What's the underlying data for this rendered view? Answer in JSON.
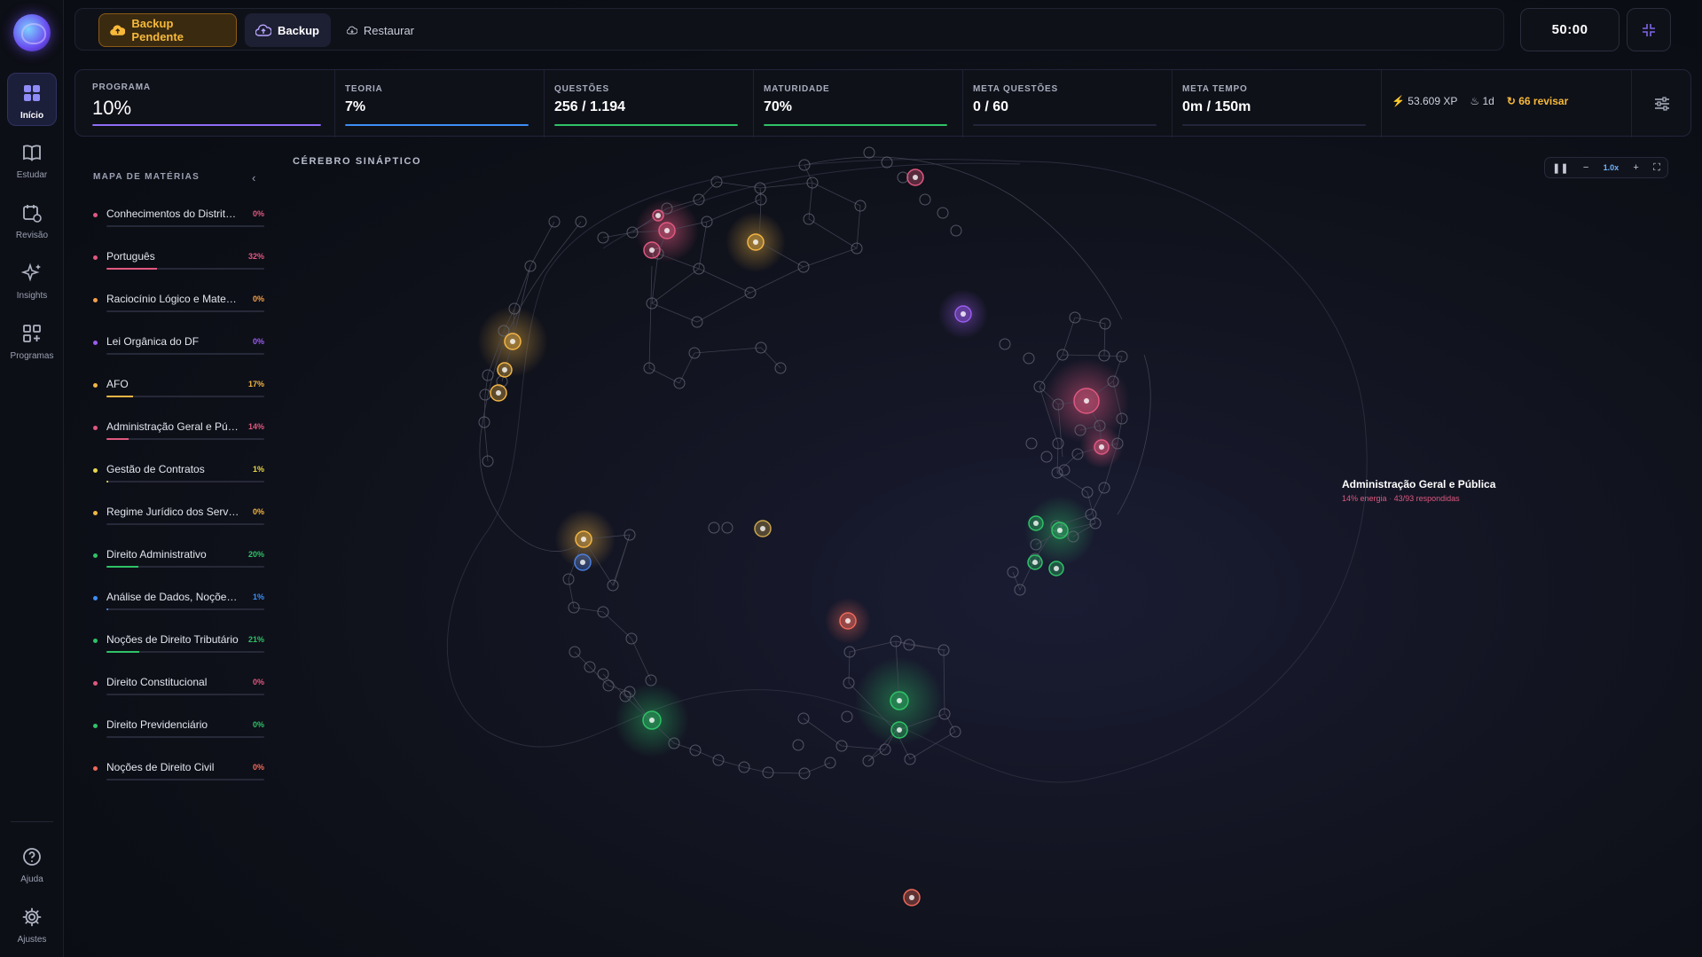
{
  "nav": {
    "items": [
      {
        "label": "Início",
        "icon": "grid-icon"
      },
      {
        "label": "Estudar",
        "icon": "book-icon"
      },
      {
        "label": "Revisão",
        "icon": "calendar-icon"
      },
      {
        "label": "Insights",
        "icon": "sparkles-icon"
      },
      {
        "label": "Programas",
        "icon": "apps-icon"
      }
    ],
    "bottom": [
      {
        "label": "Ajuda",
        "icon": "help-icon"
      },
      {
        "label": "Ajustes",
        "icon": "gear-icon"
      }
    ]
  },
  "topbar": {
    "backup_pending": "Backup Pendente",
    "backup": "Backup",
    "restore": "Restaurar",
    "timer": "50:00"
  },
  "stats": {
    "programa": {
      "label": "PROGRAMA",
      "value": "10%",
      "progress": 1.0,
      "color": "#8f6cf7"
    },
    "teoria": {
      "label": "TEORIA",
      "value": "7%",
      "progress": 1.0,
      "color": "#3d8df5"
    },
    "questoes": {
      "label": "QUESTÕES",
      "value": "256 / 1.194",
      "progress": 1.0,
      "color": "#2fc267"
    },
    "maturidade": {
      "label": "MATURIDADE",
      "value": "70%",
      "progress": 1.0,
      "color": "#2fc267"
    },
    "meta_questoes": {
      "label": "META QUESTÕES",
      "value": "0 / 60",
      "progress": 0,
      "color": "#f7b93a"
    },
    "meta_tempo": {
      "label": "META TEMPO",
      "value": "0m / 150m",
      "progress": 0,
      "color": "#e0587f"
    },
    "xp": "53.609 XP",
    "streak": "1d",
    "review": "66 revisar"
  },
  "subjects_panel": {
    "title": "MAPA DE MATÉRIAS",
    "items": [
      {
        "name": "Conhecimentos do Distrito Federal",
        "percent": "0%",
        "progress": 0,
        "color": "#e0587f"
      },
      {
        "name": "Português",
        "percent": "32%",
        "progress": 0.32,
        "color": "#e0587f"
      },
      {
        "name": "Raciocínio Lógico e Matemático",
        "percent": "0%",
        "progress": 0,
        "color": "#f5a04a"
      },
      {
        "name": "Lei Orgânica do DF",
        "percent": "0%",
        "progress": 0,
        "color": "#9b5cf0"
      },
      {
        "name": "AFO",
        "percent": "17%",
        "progress": 0.17,
        "color": "#f2b544"
      },
      {
        "name": "Administração Geral e Pública",
        "percent": "14%",
        "progress": 0.14,
        "color": "#e0587f"
      },
      {
        "name": "Gestão de Contratos",
        "percent": "1%",
        "progress": 0.01,
        "color": "#e8d84a"
      },
      {
        "name": "Regime Jurídico dos Servidores",
        "percent": "0%",
        "progress": 0,
        "color": "#f2b544"
      },
      {
        "name": "Direito Administrativo",
        "percent": "20%",
        "progress": 0.2,
        "color": "#2fc267"
      },
      {
        "name": "Análise de Dados, Noções de TI",
        "percent": "1%",
        "progress": 0.01,
        "color": "#3d8df5"
      },
      {
        "name": "Noções de Direito Tributário",
        "percent": "21%",
        "progress": 0.21,
        "color": "#2fc267"
      },
      {
        "name": "Direito Constitucional",
        "percent": "0%",
        "progress": 0,
        "color": "#e0587f"
      },
      {
        "name": "Direito Previdenciário",
        "percent": "0%",
        "progress": 0,
        "color": "#2fc267"
      },
      {
        "name": "Noções de Direito Civil",
        "percent": "0%",
        "progress": 0,
        "color": "#f06a5a"
      }
    ]
  },
  "brain": {
    "title": "CÉREBRO SINÁPTICO",
    "zoom": "1.0x",
    "tooltip": {
      "name": "Administração Geral e Pública",
      "energy": "14% energia",
      "answered": "43/93 respondidas"
    }
  }
}
